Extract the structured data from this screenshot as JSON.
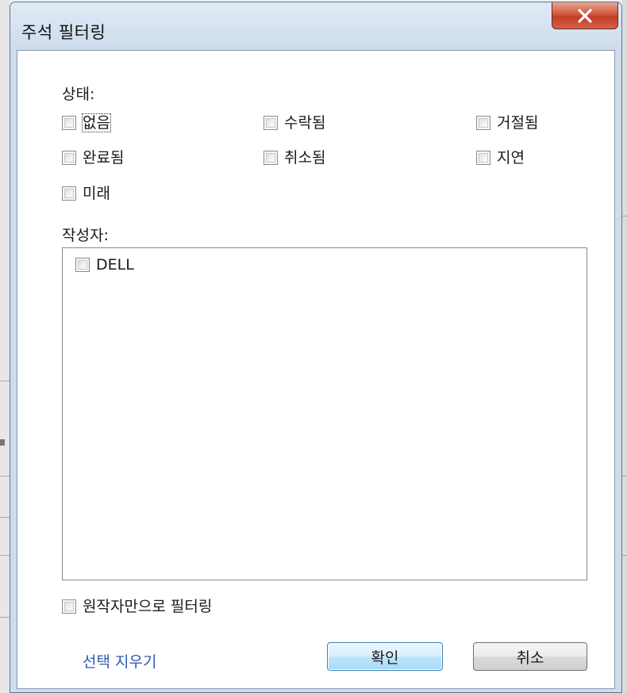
{
  "window": {
    "title": "주석 필터링",
    "close_glyph": "X"
  },
  "status": {
    "label": "상태:",
    "options": [
      {
        "label": "없음",
        "checked": false,
        "focused": true
      },
      {
        "label": "수락됨",
        "checked": false
      },
      {
        "label": "거절됨",
        "checked": false
      },
      {
        "label": "완료됨",
        "checked": false
      },
      {
        "label": "취소됨",
        "checked": false
      },
      {
        "label": "지연",
        "checked": false
      },
      {
        "label": "미래",
        "checked": false
      }
    ]
  },
  "author": {
    "label": "작성자:",
    "items": [
      {
        "label": "DELL",
        "checked": false
      }
    ]
  },
  "original_author_only": {
    "label": "원작자만으로 필터링",
    "checked": false
  },
  "footer": {
    "clear_selection": "선택 지우기",
    "ok": "확인",
    "cancel": "취소"
  },
  "colors": {
    "link": "#2a5ab0",
    "close_button": "#c43c24",
    "default_button_border": "#3c7fb1"
  }
}
